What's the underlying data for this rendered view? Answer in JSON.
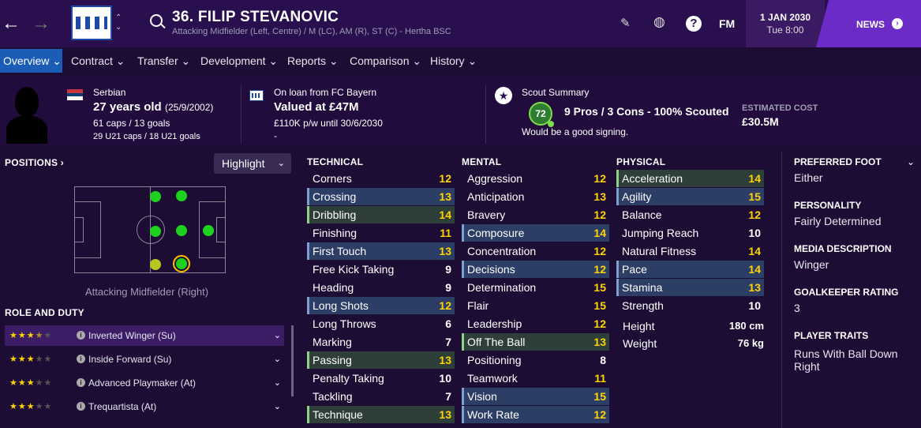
{
  "header": {
    "player_title": "36. FILIP STEVANOVIC",
    "player_subtitle": "Attacking Midfielder (Left, Centre) / M (LC), AM (R), ST (C) - Hertha BSC",
    "fm_label": "FM",
    "date": "1 JAN 2030",
    "time": "Tue 8:00",
    "news_label": "NEWS"
  },
  "tabs": [
    {
      "label": "Overview"
    },
    {
      "label": "Contract"
    },
    {
      "label": "Transfer"
    },
    {
      "label": "Development"
    },
    {
      "label": "Reports"
    },
    {
      "label": "Comparison"
    },
    {
      "label": "History"
    }
  ],
  "profile": {
    "nationality": "Serbian",
    "age": "27 years old",
    "dob": "(25/9/2002)",
    "caps": "61 caps / 13 goals",
    "u21_caps": "29 U21 caps / 18 U21 goals",
    "loan": "On loan from FC Bayern",
    "value": "Valued at £47M",
    "wage": "£110K p/w until 30/6/2030",
    "wage_sub": "-",
    "scout_title": "Scout Summary",
    "scout_rating": "72",
    "scout_summary": "9 Pros / 3 Cons - 100% Scouted",
    "scout_note": "Would be a good signing.",
    "est_label": "ESTIMATED COST",
    "est_value": "£30.5M"
  },
  "positions": {
    "title": "POSITIONS",
    "highlight": "Highlight",
    "caption": "Attacking Midfielder (Right)"
  },
  "roles": {
    "title": "ROLE AND DUTY",
    "items": [
      {
        "label": "Inverted Winger (Su)",
        "stars": 3.5
      },
      {
        "label": "Inside Forward (Su)",
        "stars": 3
      },
      {
        "label": "Advanced Playmaker (At)",
        "stars": 3
      },
      {
        "label": "Trequartista (At)",
        "stars": 3
      }
    ]
  },
  "technical": {
    "title": "TECHNICAL",
    "items": [
      {
        "name": "Corners",
        "value": "12"
      },
      {
        "name": "Crossing",
        "value": "13"
      },
      {
        "name": "Dribbling",
        "value": "14"
      },
      {
        "name": "Finishing",
        "value": "11"
      },
      {
        "name": "First Touch",
        "value": "13"
      },
      {
        "name": "Free Kick Taking",
        "value": "9"
      },
      {
        "name": "Heading",
        "value": "9"
      },
      {
        "name": "Long Shots",
        "value": "12"
      },
      {
        "name": "Long Throws",
        "value": "6"
      },
      {
        "name": "Marking",
        "value": "7"
      },
      {
        "name": "Passing",
        "value": "13"
      },
      {
        "name": "Penalty Taking",
        "value": "10"
      },
      {
        "name": "Tackling",
        "value": "7"
      },
      {
        "name": "Technique",
        "value": "13"
      }
    ]
  },
  "mental": {
    "title": "MENTAL",
    "items": [
      {
        "name": "Aggression",
        "value": "12"
      },
      {
        "name": "Anticipation",
        "value": "13"
      },
      {
        "name": "Bravery",
        "value": "12"
      },
      {
        "name": "Composure",
        "value": "14"
      },
      {
        "name": "Concentration",
        "value": "12"
      },
      {
        "name": "Decisions",
        "value": "12"
      },
      {
        "name": "Determination",
        "value": "15"
      },
      {
        "name": "Flair",
        "value": "15"
      },
      {
        "name": "Leadership",
        "value": "12"
      },
      {
        "name": "Off The Ball",
        "value": "13"
      },
      {
        "name": "Positioning",
        "value": "8"
      },
      {
        "name": "Teamwork",
        "value": "11"
      },
      {
        "name": "Vision",
        "value": "15"
      },
      {
        "name": "Work Rate",
        "value": "12"
      }
    ]
  },
  "physical": {
    "title": "PHYSICAL",
    "items": [
      {
        "name": "Acceleration",
        "value": "14"
      },
      {
        "name": "Agility",
        "value": "15"
      },
      {
        "name": "Balance",
        "value": "12"
      },
      {
        "name": "Jumping Reach",
        "value": "10"
      },
      {
        "name": "Natural Fitness",
        "value": "14"
      },
      {
        "name": "Pace",
        "value": "14"
      },
      {
        "name": "Stamina",
        "value": "13"
      },
      {
        "name": "Strength",
        "value": "10"
      }
    ],
    "height_label": "Height",
    "height": "180 cm",
    "weight_label": "Weight",
    "weight": "76 kg"
  },
  "side": {
    "foot_label": "PREFERRED FOOT",
    "foot": "Either",
    "personality_label": "PERSONALITY",
    "personality": "Fairly Determined",
    "media_label": "MEDIA DESCRIPTION",
    "media": "Winger",
    "gk_label": "GOALKEEPER RATING",
    "gk": "3",
    "traits_label": "PLAYER TRAITS",
    "traits": "Runs With Ball Down Right"
  },
  "colors": {
    "white": "#ffffff",
    "yellow": "#ffd400",
    "highlight_blue": "#2c3e66",
    "highlight_green": "#2e3f3a",
    "accent": "#6a2bc7"
  }
}
